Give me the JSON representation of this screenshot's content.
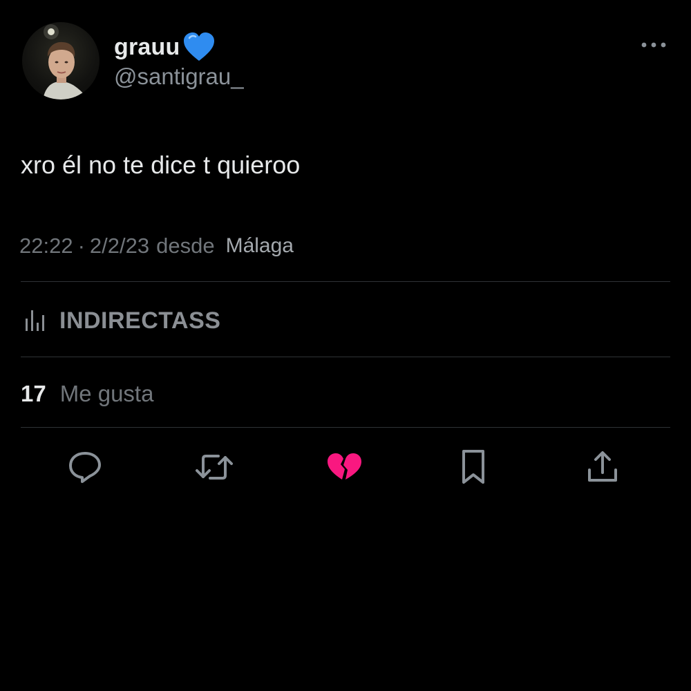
{
  "tweet": {
    "display_name": "grauu",
    "name_emoji": "blue-heart-icon",
    "handle": "@santigrau_",
    "text": "xro él no te dice t quieroo",
    "time": "22:22",
    "separator": "·",
    "date": "2/2/23",
    "desde": "desde",
    "place": "Málaga",
    "analytics_label": "INDIRECTASS",
    "like_count": "17",
    "like_label": "Me gusta"
  },
  "actions": [
    {
      "name": "reply-icon"
    },
    {
      "name": "retweet-icon"
    },
    {
      "name": "broken-heart-icon"
    },
    {
      "name": "bookmark-icon"
    },
    {
      "name": "share-icon"
    }
  ],
  "colors": {
    "background": "#000000",
    "text": "#e7e9ea",
    "muted": "#71767b",
    "divider": "#2f3336",
    "like_pink": "#f91880",
    "emoji_blue": "#2f8cf0"
  }
}
